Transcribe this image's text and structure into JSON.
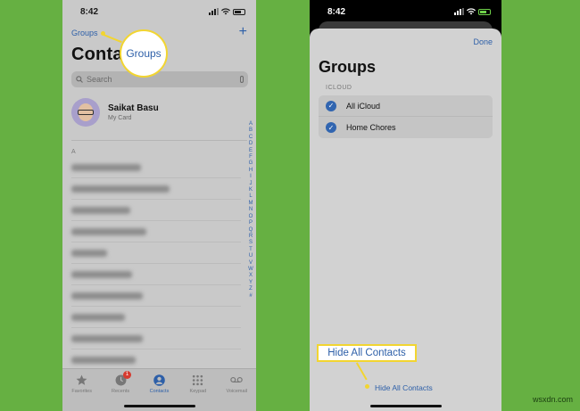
{
  "left_screen": {
    "time": "8:42",
    "nav": {
      "groups_label": "Groups",
      "add_label": "+"
    },
    "title": "Conta",
    "search": {
      "placeholder": "Search"
    },
    "my_card": {
      "name": "Saikat Basu",
      "subtitle": "My Card"
    },
    "section_letter": "A",
    "index_letters": [
      "A",
      "B",
      "C",
      "D",
      "E",
      "F",
      "G",
      "H",
      "I",
      "J",
      "K",
      "L",
      "M",
      "N",
      "O",
      "P",
      "Q",
      "R",
      "S",
      "T",
      "U",
      "V",
      "W",
      "X",
      "Y",
      "Z",
      "#"
    ],
    "tabs": [
      {
        "label": "Favorites",
        "icon": "star-icon",
        "active": false
      },
      {
        "label": "Recents",
        "icon": "clock-icon",
        "active": false,
        "badge": "1"
      },
      {
        "label": "Contacts",
        "icon": "person-circle-icon",
        "active": true
      },
      {
        "label": "Keypad",
        "icon": "keypad-icon",
        "active": false
      },
      {
        "label": "Voicemail",
        "icon": "voicemail-icon",
        "active": false
      }
    ]
  },
  "right_screen": {
    "time": "8:42",
    "done_label": "Done",
    "title": "Groups",
    "section_label": "ICLOUD",
    "groups": [
      {
        "name": "All iCloud",
        "checked": true
      },
      {
        "name": "Home Chores",
        "checked": true
      }
    ],
    "hide_all_label": "Hide All Contacts"
  },
  "callouts": {
    "groups": "Groups",
    "hide_all": "Hide All Contacts"
  },
  "watermark": "wsxdn.com",
  "colors": {
    "background": "#66b042",
    "link_blue": "#2d5fa8",
    "callout_border": "#f2d531",
    "badge_red": "#d63a2f"
  }
}
